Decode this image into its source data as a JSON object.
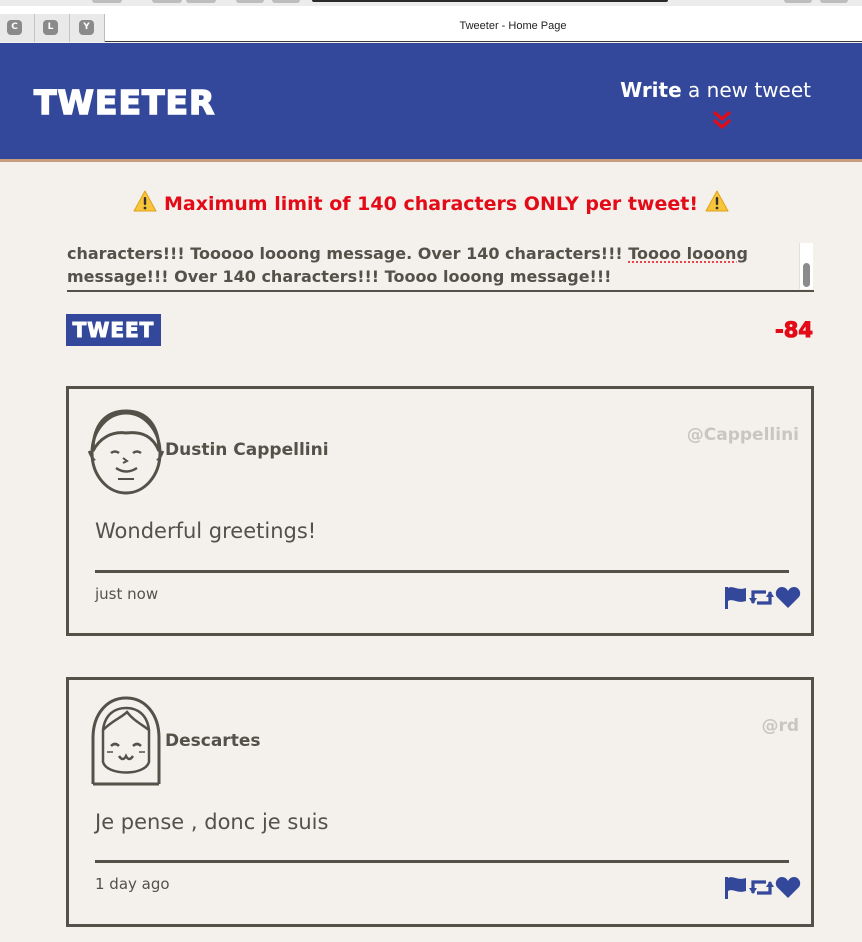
{
  "browser": {
    "window_title": "Tweeter - Home Page",
    "extensions": [
      "C",
      "L",
      "Y"
    ]
  },
  "nav": {
    "logo": "TWEETER",
    "compose_bold": "Write",
    "compose_rest": " a new tweet"
  },
  "composer": {
    "warning": "Maximum limit of 140 characters ONLY per tweet!",
    "text_line1_parts": [
      "characters!!!  Tooooo looong message.  Over 140 characters!!!  ",
      "Toooo looong"
    ],
    "text_line2": "message!!!   Over 140 characters!!!   Toooo looong message!!!",
    "submit_label": "TWEET",
    "counter": "-84"
  },
  "tweets": [
    {
      "name": "Dustin Cappellini",
      "handle": "@Cappellini",
      "content": "Wonderful greetings!",
      "time": "just now"
    },
    {
      "name": "Descartes",
      "handle": "@rd",
      "content": "Je pense , donc je suis",
      "time": "1 day ago"
    }
  ],
  "icons": {
    "compose_chevron": "double-chevron-down-icon",
    "warning": "warning-icon",
    "flag": "flag-icon",
    "retweet": "retweet-icon",
    "like": "heart-icon"
  },
  "colors": {
    "brand_blue": "#33489a",
    "alert_red": "#e30b17",
    "text_dark": "#545149",
    "background": "#f4f1ec",
    "handle_gray": "#c9c6c0"
  }
}
